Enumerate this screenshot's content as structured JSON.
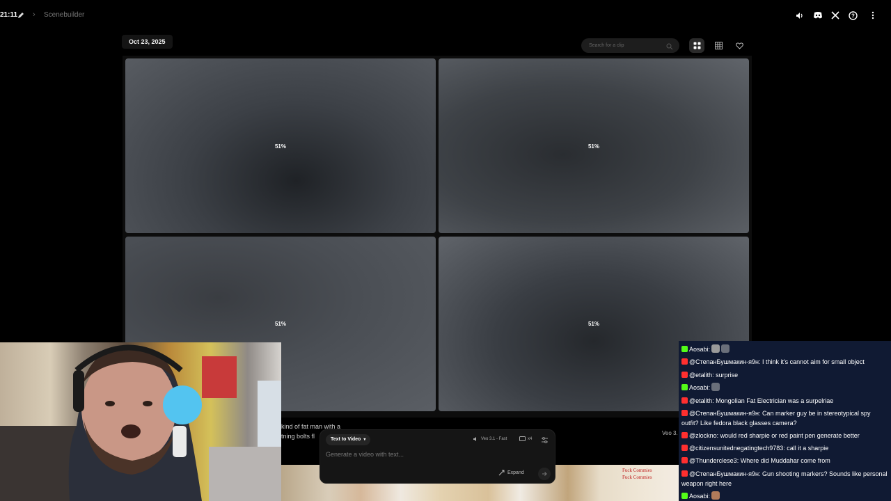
{
  "topbar": {
    "time": "21:11",
    "breadcrumb": "Scenebuilder",
    "icons": [
      "volume-icon",
      "discord-icon",
      "x-icon",
      "help-icon",
      "more-icon"
    ]
  },
  "toolbar": {
    "date": "Oct 23, 2025",
    "search_placeholder": "Search for a clip"
  },
  "tiles": [
    {
      "progress": "51%"
    },
    {
      "progress": "51%"
    },
    {
      "progress": "51%"
    },
    {
      "progress": "51%"
    }
  ],
  "prompt": {
    "peek_line1": "kind of fat man with a",
    "peek_line2": "tning bolts fl",
    "veo_peek": "Veo 3.",
    "mode": "Text to Video",
    "model": "Veo 3.1 - Fast",
    "count": "x4",
    "placeholder": "Generate a video with text...",
    "expand": "Expand"
  },
  "wall": {
    "note1": "Fuck Commies",
    "note2": "Fuck Commies"
  },
  "chat": [
    {
      "platform": "kick",
      "user": "Aosabi",
      "text": ""
    },
    {
      "platform": "yt",
      "user": "@СтепанБушмакин-я9н",
      "text": "I think it's cannot aim for small object"
    },
    {
      "platform": "yt",
      "user": "@etalith",
      "text": "surprise"
    },
    {
      "platform": "kick",
      "user": "Aosabi",
      "text": ""
    },
    {
      "platform": "yt",
      "user": "@etalith",
      "text": "Mongolian Fat Electrician was a surpelriae"
    },
    {
      "platform": "yt",
      "user": "@СтепанБушмакин-я9н",
      "text": "Can marker guy be in stereotypical spy outfit? Like fedora black glasses camera?"
    },
    {
      "platform": "yt",
      "user": "@zlockno",
      "text": "would red sharpie or red paint pen generate better"
    },
    {
      "platform": "yt",
      "user": "@citizensunitednegatingtech9783",
      "text": "call it a sharpie"
    },
    {
      "platform": "yt",
      "user": "@Thunderclese3",
      "text": "Where did Muddahar come from"
    },
    {
      "platform": "yt",
      "user": "@СтепанБушмакин-я9н",
      "text": "Gun shooting markers? Sounds like personal weapon right here"
    },
    {
      "platform": "kick",
      "user": "Aosabi",
      "text": ""
    }
  ],
  "colors": {
    "chat_bg": "#101a33",
    "kick": "#53fc18",
    "youtube": "#ff2f2f"
  }
}
